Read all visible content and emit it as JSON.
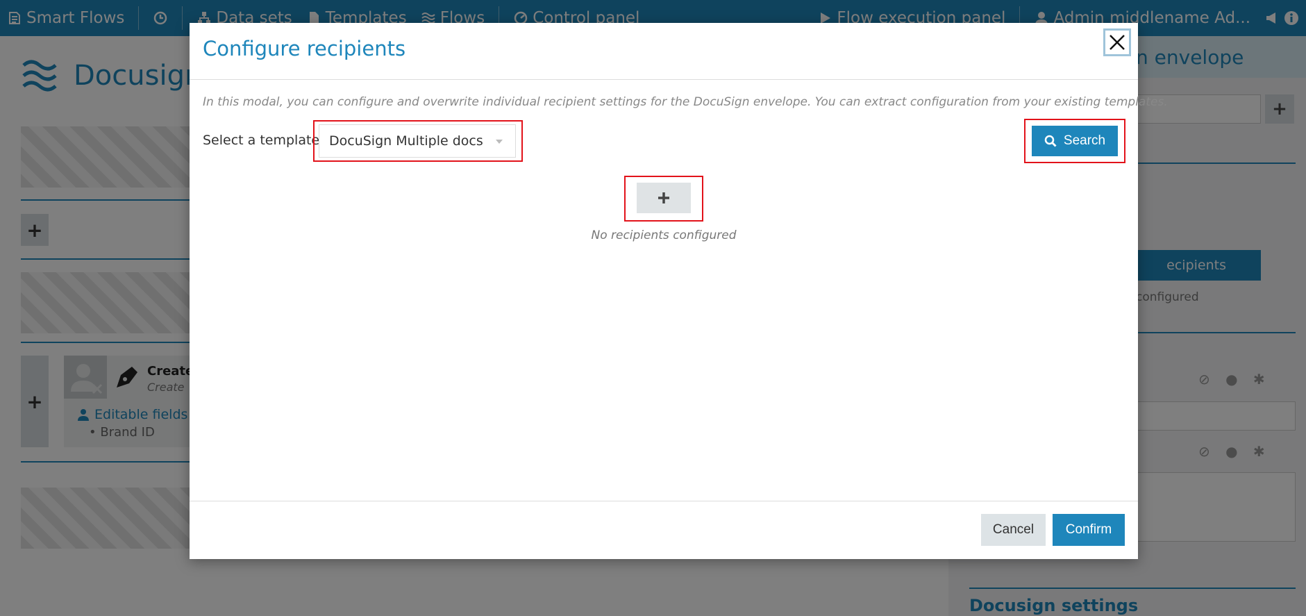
{
  "navbar": {
    "brand": "Smart Flows",
    "items": [
      {
        "label": "Data sets",
        "icon": "sitemap-icon"
      },
      {
        "label": "Templates",
        "icon": "file-icon"
      },
      {
        "label": "Flows",
        "icon": "waves-icon"
      },
      {
        "label": "Control panel",
        "icon": "gauge-icon"
      },
      {
        "label": "Flow execution panel",
        "icon": "play-icon"
      },
      {
        "label": "Admin middlename Ad...",
        "icon": "user-icon"
      }
    ]
  },
  "background": {
    "page_title": "Docusign",
    "step": {
      "title": "Create",
      "subtitle": "Create",
      "editable_fields_label": "Editable fields",
      "bullet": "Brand ID"
    },
    "right_panel": {
      "title": "n envelope",
      "button_label": "ecipients",
      "note": "configured",
      "section_title": "Docusign settings"
    }
  },
  "modal": {
    "title": "Configure recipients",
    "intro": "In this modal, you can configure and overwrite individual recipient settings for the DocuSign envelope. You can extract configuration from your existing templates.",
    "template_label": "Select a template",
    "template_value": "DocuSign Multiple docs",
    "search_label": "Search",
    "empty_text": "No recipients configured",
    "cancel_label": "Cancel",
    "confirm_label": "Confirm"
  },
  "colors": {
    "accent": "#1e86bb",
    "highlight": "#e2121a"
  }
}
